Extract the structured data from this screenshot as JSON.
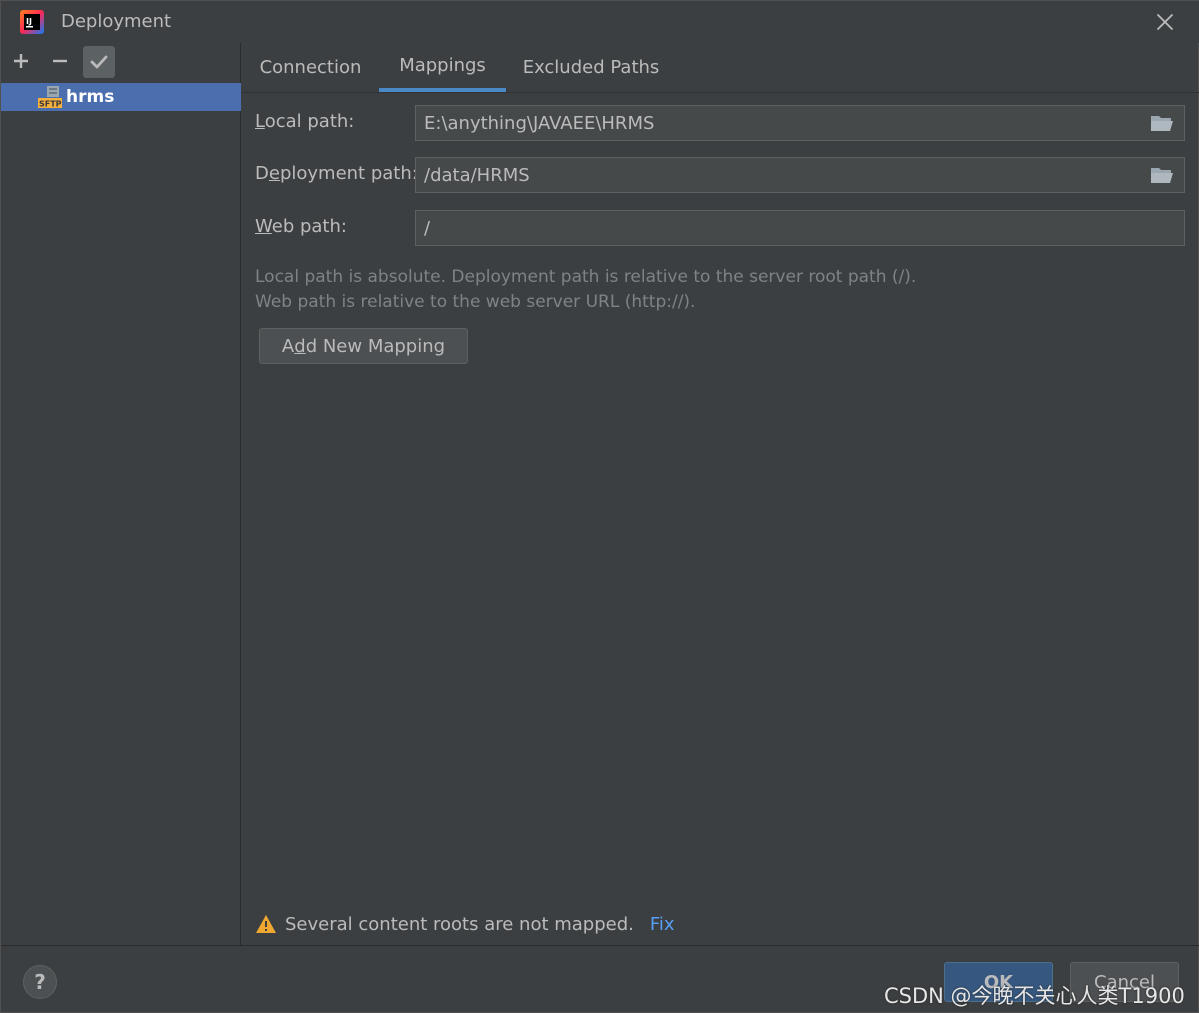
{
  "window": {
    "title": "Deployment",
    "app_icon": "intellij-idea-icon",
    "close_icon": "close-icon"
  },
  "sidebar": {
    "toolbar": {
      "add_icon": "plus-icon",
      "remove_icon": "minus-icon",
      "default_icon": "check-icon"
    },
    "servers": [
      {
        "label": "hrms",
        "icon": "sftp-server-icon",
        "icon_text": "SFTP",
        "selected": true
      }
    ]
  },
  "tabs": [
    {
      "label": "Connection",
      "active": false
    },
    {
      "label": "Mappings",
      "active": true
    },
    {
      "label": "Excluded Paths",
      "active": false
    }
  ],
  "mappings": {
    "local_path": {
      "label_mnemonic": "L",
      "label_rest": "ocal path:",
      "value": "E:\\anything\\JAVAEE\\HRMS"
    },
    "deployment_path": {
      "label_pre": "D",
      "label_mnemonic": "e",
      "label_rest": "ployment path:",
      "value": "/data/HRMS"
    },
    "web_path": {
      "label_mnemonic": "W",
      "label_rest": "eb path:",
      "value": "/"
    },
    "hint_line1": "Local path is absolute. Deployment path is relative to the server root path (/).",
    "hint_line2": "Web path is relative to the web server URL (http://).",
    "add_mapping": {
      "pre": "A",
      "mnemonic": "d",
      "rest": "d New Mapping"
    }
  },
  "warning": {
    "text": "Several content roots are not mapped.",
    "fix_label": "Fix",
    "color": "#f0a732"
  },
  "footer": {
    "help_label": "?",
    "ok_label": "OK",
    "cancel_label": "Cancel"
  },
  "watermark": "CSDN @今晚不关心人类T1900",
  "colors": {
    "background": "#3c3f41",
    "selection": "#4b6eaf",
    "tab_underline": "#4a88c7",
    "link": "#589df6",
    "ok_button": "#365880"
  }
}
